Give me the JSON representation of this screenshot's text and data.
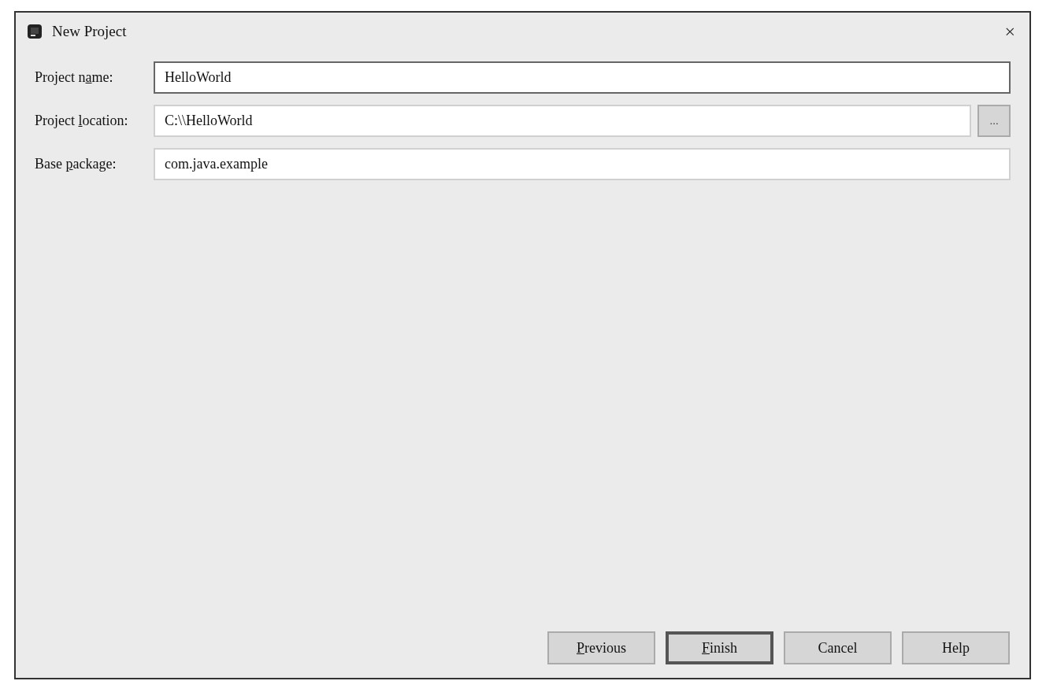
{
  "window": {
    "title": "New Project",
    "close": "×"
  },
  "fields": [
    {
      "label": {
        "before": "Project n",
        "key": "a",
        "after": "me:"
      },
      "value": "HelloWorld",
      "focused": true
    },
    {
      "label": {
        "before": "Project ",
        "key": "l",
        "after": "ocation:"
      },
      "value": "C:\\\\HelloWorld",
      "focused": false,
      "browse": "..."
    },
    {
      "label": {
        "before": "Base ",
        "key": "p",
        "after": "ackage:"
      },
      "value": "com.java.example",
      "focused": false
    }
  ],
  "buttons": [
    {
      "label": {
        "key": "P",
        "after": "revious"
      },
      "default": false
    },
    {
      "label": {
        "key": "F",
        "after": "inish"
      },
      "default": true
    },
    {
      "label": {
        "after": "Cancel"
      },
      "default": false
    },
    {
      "label": {
        "after": "Help"
      },
      "default": false
    }
  ]
}
